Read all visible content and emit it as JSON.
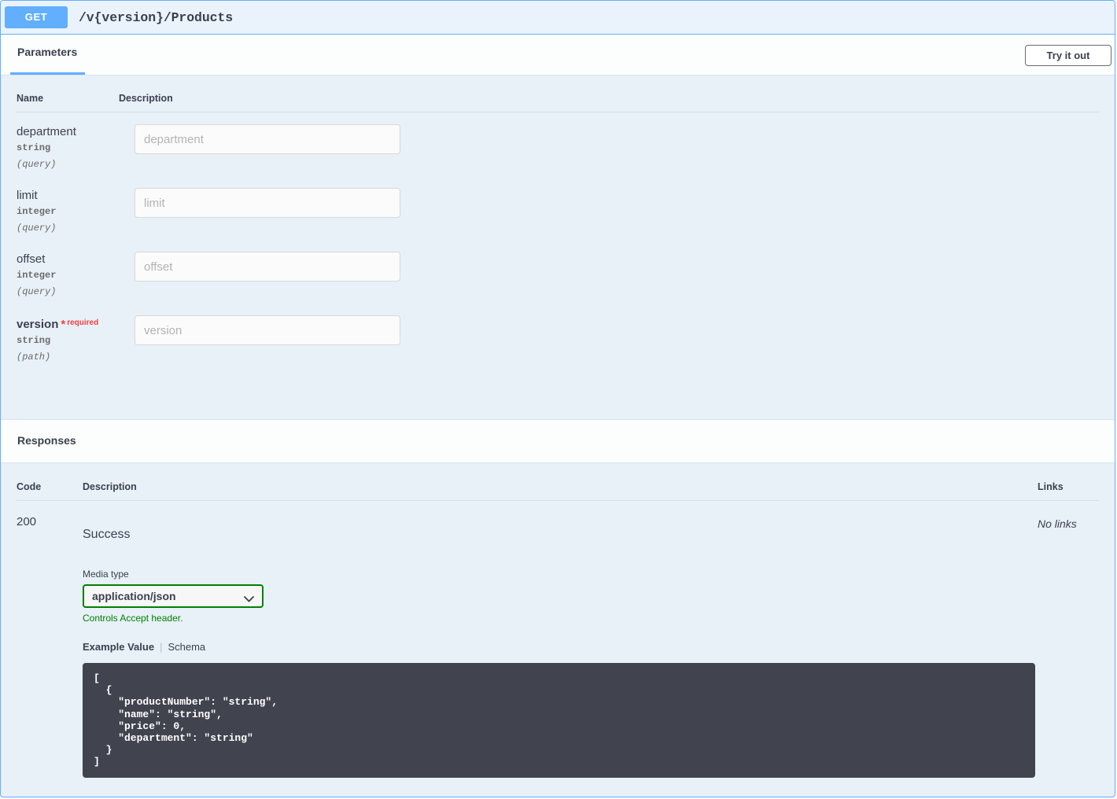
{
  "operation": {
    "method": "GET",
    "path": "/v{version}/Products"
  },
  "parameters_section": {
    "tab_label": "Parameters",
    "try_it_out_label": "Try it out",
    "columns": {
      "name": "Name",
      "description": "Description"
    },
    "rows": [
      {
        "name": "department",
        "type": "string",
        "in": "(query)",
        "required": false,
        "placeholder": "department",
        "value": ""
      },
      {
        "name": "limit",
        "type": "integer",
        "in": "(query)",
        "required": false,
        "placeholder": "limit",
        "value": ""
      },
      {
        "name": "offset",
        "type": "integer",
        "in": "(query)",
        "required": false,
        "placeholder": "offset",
        "value": ""
      },
      {
        "name": "version",
        "type": "string",
        "in": "(path)",
        "required": true,
        "required_star": "*",
        "required_label": "required",
        "placeholder": "version",
        "value": ""
      }
    ]
  },
  "responses_section": {
    "title": "Responses",
    "columns": {
      "code": "Code",
      "description": "Description",
      "links": "Links"
    },
    "row": {
      "code": "200",
      "description": "Success",
      "links": "No links",
      "media_type_label": "Media type",
      "media_type_value": "application/json",
      "media_type_hint": "Controls Accept header.",
      "example_tab_active": "Example Value",
      "schema_tab": "Schema",
      "example_json": "[\n  {\n    \"productNumber\": \"string\",\n    \"name\": \"string\",\n    \"price\": 0,\n    \"department\": \"string\"\n  }\n]"
    }
  },
  "colors": {
    "method_get": "#61affe",
    "border_accent": "#61affe",
    "required_red": "#f93e3e",
    "select_green": "#008000",
    "code_bg": "#41444e",
    "panel_bg": "#e8f0f8"
  }
}
